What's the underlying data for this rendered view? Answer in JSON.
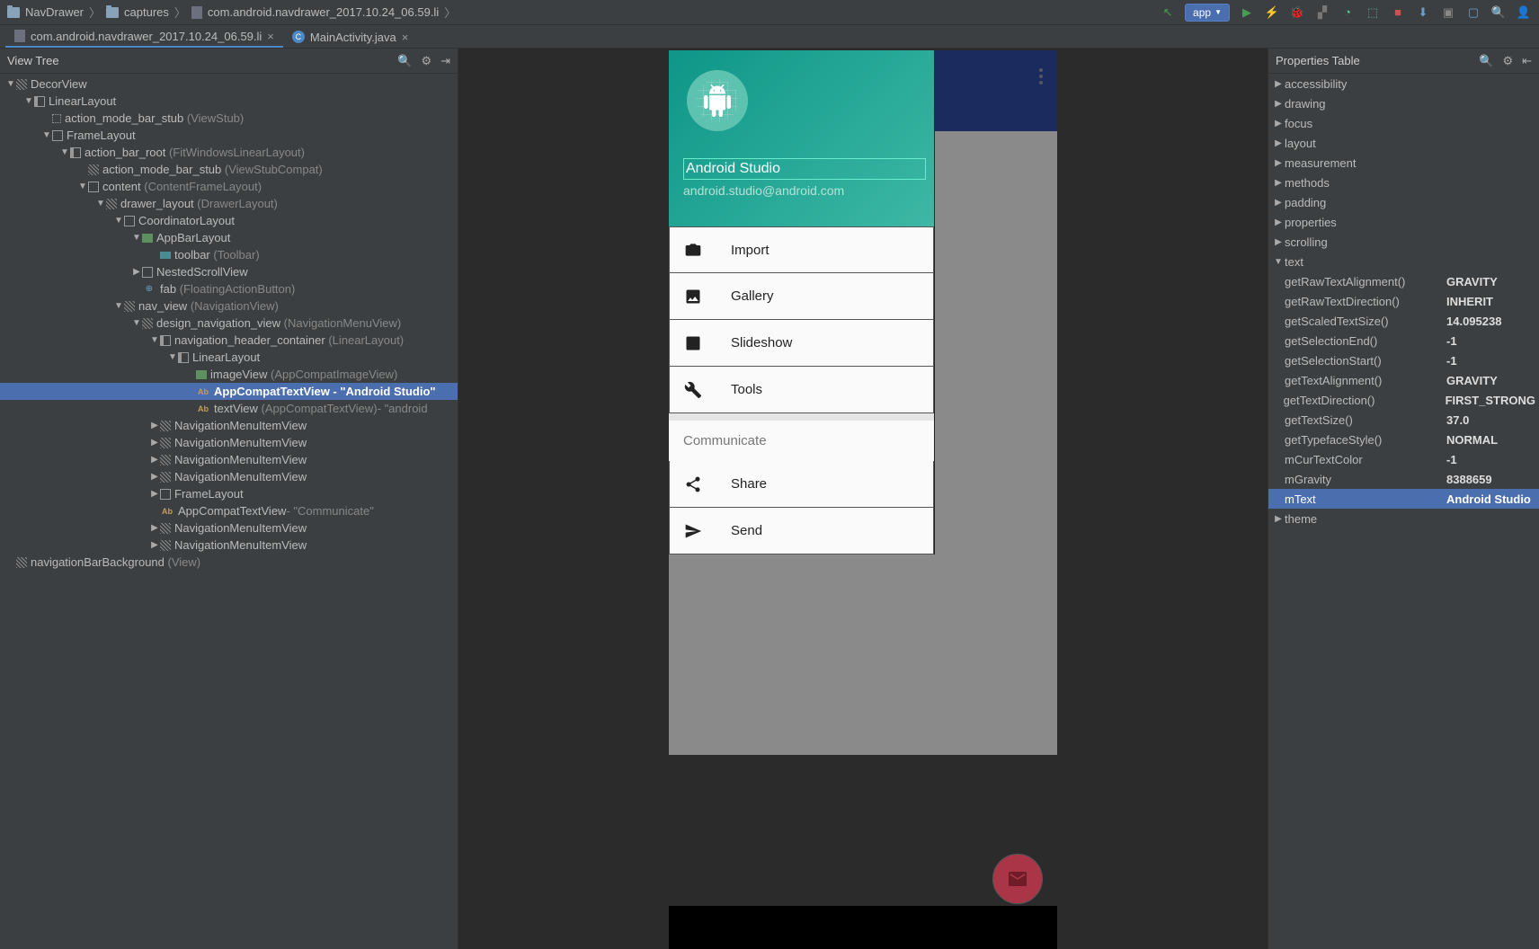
{
  "breadcrumbs": {
    "item0": "NavDrawer",
    "item1": "captures",
    "item2": "com.android.navdrawer_2017.10.24_06.59.li"
  },
  "toolbar": {
    "app_label": "app"
  },
  "tabs": {
    "tab0": "com.android.navdrawer_2017.10.24_06.59.li",
    "tab1": "MainActivity.java"
  },
  "left": {
    "title": "View Tree",
    "nodes": {
      "n0": "DecorView",
      "n1": "LinearLayout",
      "n2": "action_mode_bar_stub",
      "n2h": "(ViewStub)",
      "n3": "FrameLayout",
      "n4": "action_bar_root",
      "n4h": "(FitWindowsLinearLayout)",
      "n5": "action_mode_bar_stub",
      "n5h": "(ViewStubCompat)",
      "n6": "content",
      "n6h": "(ContentFrameLayout)",
      "n7": "drawer_layout",
      "n7h": "(DrawerLayout)",
      "n8": "CoordinatorLayout",
      "n9": "AppBarLayout",
      "n10": "toolbar",
      "n10h": "(Toolbar)",
      "n11": "NestedScrollView",
      "n12": "fab",
      "n12h": "(FloatingActionButton)",
      "n13": "nav_view",
      "n13h": "(NavigationView)",
      "n14": "design_navigation_view",
      "n14h": "(NavigationMenuView)",
      "n15": "navigation_header_container",
      "n15h": "(LinearLayout)",
      "n16": "LinearLayout",
      "n17": "imageView",
      "n17h": "(AppCompatImageView)",
      "n18": "AppCompatTextView - \"Android Studio\"",
      "n19": "textView",
      "n19h": "(AppCompatTextView)",
      "n19h2": " - \"android",
      "n20": "NavigationMenuItemView",
      "n24": "FrameLayout",
      "n25": "AppCompatTextView",
      "n25h": " - \"Communicate\"",
      "n28": "navigationBarBackground",
      "n28h": "(View)"
    }
  },
  "drawer": {
    "name": "Android Studio",
    "email": "android.studio@android.com",
    "items": {
      "i0": "Import",
      "i1": "Gallery",
      "i2": "Slideshow",
      "i3": "Tools",
      "group": "Communicate",
      "i4": "Share",
      "i5": "Send"
    }
  },
  "right": {
    "title": "Properties Table",
    "groups": {
      "g0": "accessibility",
      "g1": "drawing",
      "g2": "focus",
      "g3": "layout",
      "g4": "measurement",
      "g5": "methods",
      "g6": "padding",
      "g7": "properties",
      "g8": "scrolling",
      "g9": "text",
      "g10": "theme"
    },
    "props": {
      "p0k": "getRawTextAlignment()",
      "p0v": "GRAVITY",
      "p1k": "getRawTextDirection()",
      "p1v": "INHERIT",
      "p2k": "getScaledTextSize()",
      "p2v": "14.095238",
      "p3k": "getSelectionEnd()",
      "p3v": "-1",
      "p4k": "getSelectionStart()",
      "p4v": "-1",
      "p5k": "getTextAlignment()",
      "p5v": "GRAVITY",
      "p6k": "getTextDirection()",
      "p6v": "FIRST_STRONG",
      "p7k": "getTextSize()",
      "p7v": "37.0",
      "p8k": "getTypefaceStyle()",
      "p8v": "NORMAL",
      "p9k": "mCurTextColor",
      "p9v": "-1",
      "p10k": "mGravity",
      "p10v": "8388659",
      "p11k": "mText",
      "p11v": "Android Studio"
    }
  }
}
